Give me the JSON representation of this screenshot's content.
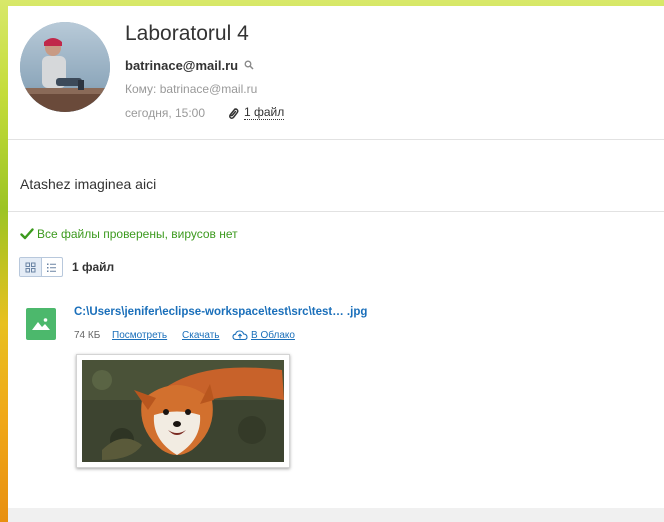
{
  "message": {
    "subject": "Laboratorul 4",
    "sender": "batrinace@mail.ru",
    "recipient": "Кому: batrinace@mail.ru",
    "date": "сегодня, 15:00",
    "attachments_link": "1 файл",
    "body": "Atashez imaginea aici"
  },
  "attachments": {
    "virus_status": "Все файлы проверены, вирусов нет",
    "count_label": "1 файл",
    "files": [
      {
        "name": "C:\\Users\\jenifer\\eclipse-workspace\\test\\src\\test… .jpg",
        "size": "74 КБ",
        "view_label": "Посмотреть",
        "download_label": "Скачать",
        "cloud_label": "В Облако",
        "icon": "image-file-icon"
      }
    ]
  },
  "colors": {
    "link": "#1a6fba",
    "success": "#3c9a1e",
    "file_icon": "#4cb86c"
  }
}
